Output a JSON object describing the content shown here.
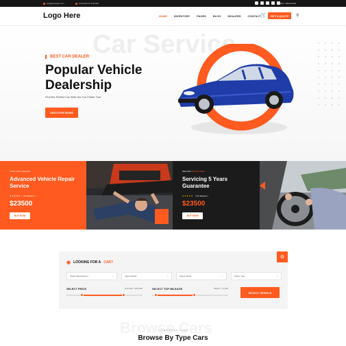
{
  "topbar": {
    "email": "info@example.com",
    "hours": "10:00 AM To 6:00 PM",
    "login": "LOGIN / REGISTER",
    "social_icons": [
      "facebook-icon",
      "twitter-icon",
      "google-icon",
      "instagram-icon",
      "linkedin-icon"
    ]
  },
  "nav": {
    "logo": "Logo Here",
    "menu": [
      "HOME",
      "INVENTORY",
      "PAGES",
      "BLOG",
      "DEALERS",
      "CONTACT"
    ],
    "active_index": 0,
    "quote_button": "GET A QUOTE",
    "accent": "#ff5a1f"
  },
  "hero": {
    "watermark": "Car Service",
    "tag": "BEST CAR DEALER",
    "headline": "Popular Vehicle Dealership",
    "subline": "Find the Perfect Car With Our Car Finder Tool",
    "cta": "DISCOVER MORE"
  },
  "promos": [
    {
      "crumb": "USED CAR  /  DEALER",
      "title": "Advanced Vehicle Repair Service",
      "stars": "★★★★★",
      "reviews": "( 5.0 Review )",
      "price": "$23500",
      "button": "BUY NOW"
    },
    {
      "crumb_a": "DEALER  /  ",
      "crumb_b": "BRAND NEW",
      "title": "Servicing 5 Years Guarantee",
      "stars": "★★★★★",
      "reviews": "( 5.0 Review )",
      "price": "$23500",
      "button": "BUY NOW"
    }
  ],
  "finder": {
    "title_a": "LOOKING FOR A ",
    "title_b": "CAR?",
    "selects": [
      "Select Manufacturer",
      "Select Model",
      "Select Model",
      "Select Year"
    ],
    "price": {
      "label": "SELECT PRICE",
      "value": "$ 40,000 - $ 80,000",
      "low": 0.2,
      "high": 0.75
    },
    "mileage": {
      "label": "SELECT TOP MILEAGE",
      "value": "MILES - 47,000",
      "low": 0.05,
      "high": 0.55
    },
    "button": "SELECT VEHICLE"
  },
  "categories": {
    "watermark": "Browse Cars",
    "kicker": "CATEGORIES CARS",
    "title": "Browse By Type Cars"
  }
}
